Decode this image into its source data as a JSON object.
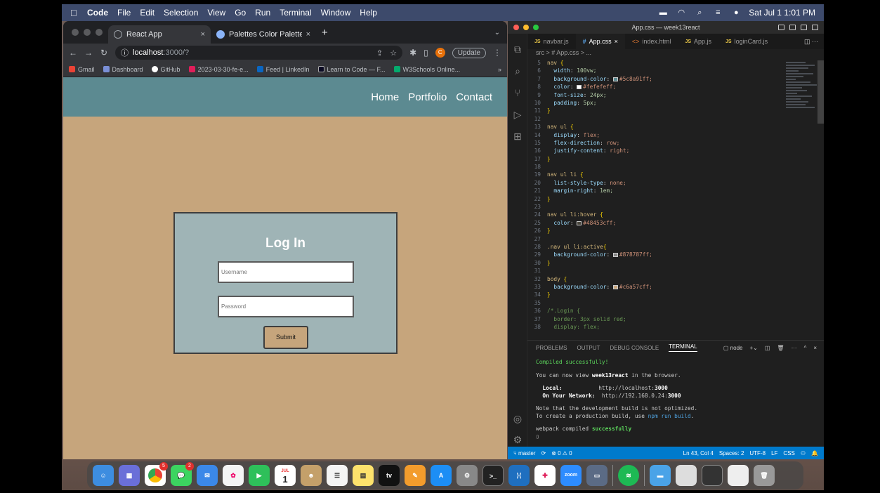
{
  "menubar": {
    "app": "Code",
    "items": [
      "File",
      "Edit",
      "Selection",
      "View",
      "Go",
      "Run",
      "Terminal",
      "Window",
      "Help"
    ],
    "clock": "Sat Jul 1  1:01 PM"
  },
  "chrome": {
    "tabs": [
      {
        "label": "React App",
        "close": "×"
      },
      {
        "label": "Palettes Color Palettes - Coolo",
        "close": "×"
      }
    ],
    "new_tab": "+",
    "url_host": "localhost",
    "url_path": ":3000/?",
    "update_label": "Update",
    "avatar_letter": "C",
    "bookmarks": [
      "Gmail",
      "Dashboard",
      "GitHub",
      "2023-03-30-fe-e...",
      "Feed | LinkedIn",
      "Learn to Code — F...",
      "W3Schools Online..."
    ],
    "bookmarks_more": "»"
  },
  "app": {
    "nav": [
      "Home",
      "Portfolio",
      "Contact"
    ],
    "login_title": "Log In",
    "username_placeholder": "Username",
    "password_placeholder": "Password",
    "submit_label": "Submit",
    "colors": {
      "nav_bg": "#5c8a91",
      "body_bg": "#c6a57c",
      "nav_text": "#fefefe"
    }
  },
  "vscode": {
    "title": "App.css — week13react",
    "tabs": [
      {
        "label": "navbar.js",
        "type": "JS"
      },
      {
        "label": "App.css",
        "type": "#"
      },
      {
        "label": "index.html",
        "type": "<>"
      },
      {
        "label": "App.js",
        "type": "JS"
      },
      {
        "label": "loginCard.js",
        "type": "JS"
      }
    ],
    "breadcrumb": "src > # App.css > ...",
    "code": [
      {
        "n": "5",
        "t": "nav {"
      },
      {
        "n": "6",
        "t": "  width: 100vw;"
      },
      {
        "n": "7",
        "t": "  background-color: #5c8a91ff;"
      },
      {
        "n": "8",
        "t": "  color: #fefefeff;"
      },
      {
        "n": "9",
        "t": "  font-size: 24px;"
      },
      {
        "n": "10",
        "t": "  padding: 5px;"
      },
      {
        "n": "11",
        "t": "}"
      },
      {
        "n": "12",
        "t": ""
      },
      {
        "n": "13",
        "t": "nav ul {"
      },
      {
        "n": "14",
        "t": "  display: flex;"
      },
      {
        "n": "15",
        "t": "  flex-direction: row;"
      },
      {
        "n": "16",
        "t": "  justify-content: right;"
      },
      {
        "n": "17",
        "t": "}"
      },
      {
        "n": "18",
        "t": ""
      },
      {
        "n": "19",
        "t": "nav ul li {"
      },
      {
        "n": "20",
        "t": "  list-style-type: none;"
      },
      {
        "n": "21",
        "t": "  margin-right: 1em;"
      },
      {
        "n": "22",
        "t": "}"
      },
      {
        "n": "23",
        "t": ""
      },
      {
        "n": "24",
        "t": "nav ul li:hover {"
      },
      {
        "n": "25",
        "t": "  color: #48453cff;"
      },
      {
        "n": "26",
        "t": "}"
      },
      {
        "n": "27",
        "t": ""
      },
      {
        "n": "28",
        "t": ".nav ul li:active{"
      },
      {
        "n": "29",
        "t": "  background-color: #878787ff;"
      },
      {
        "n": "30",
        "t": "}"
      },
      {
        "n": "31",
        "t": ""
      },
      {
        "n": "32",
        "t": "body {"
      },
      {
        "n": "33",
        "t": "  background-color: #c6a57cff;"
      },
      {
        "n": "34",
        "t": "}"
      },
      {
        "n": "35",
        "t": ""
      },
      {
        "n": "36",
        "t": "/*.Login {"
      },
      {
        "n": "37",
        "t": "  border: 3px solid red;"
      },
      {
        "n": "38",
        "t": "  display: flex;"
      }
    ],
    "panel_tabs": [
      "PROBLEMS",
      "OUTPUT",
      "DEBUG CONSOLE",
      "TERMINAL"
    ],
    "panel_shell": "node",
    "terminal": {
      "compiled": "Compiled successfully!",
      "view_prefix": "You can now view ",
      "project": "week13react",
      "view_suffix": " in the browser.",
      "local_label": "Local:",
      "local_url_pre": "http://localhost:",
      "local_port": "3000",
      "net_label": "On Your Network:",
      "net_url_pre": "http://192.168.0.24:",
      "net_port": "3000",
      "note1": "Note that the development build is not optimized.",
      "note2_pre": "To create a production build, use ",
      "note2_cmd": "npm run build",
      "note2_post": ".",
      "webpack_pre": "webpack compiled ",
      "webpack_ok": "successfully"
    },
    "status": {
      "branch": "master",
      "problems": "⊗ 0 ⚠ 0",
      "position": "Ln 43, Col 4",
      "spaces": "Spaces: 2",
      "encoding": "UTF-8",
      "eol": "LF",
      "lang": "CSS"
    }
  },
  "dock": {
    "badges": {
      "chrome": "5",
      "messages": "2"
    },
    "calendar_month": "JUL",
    "calendar_day": "1",
    "tv": "tv",
    "zoom": "zoom"
  }
}
